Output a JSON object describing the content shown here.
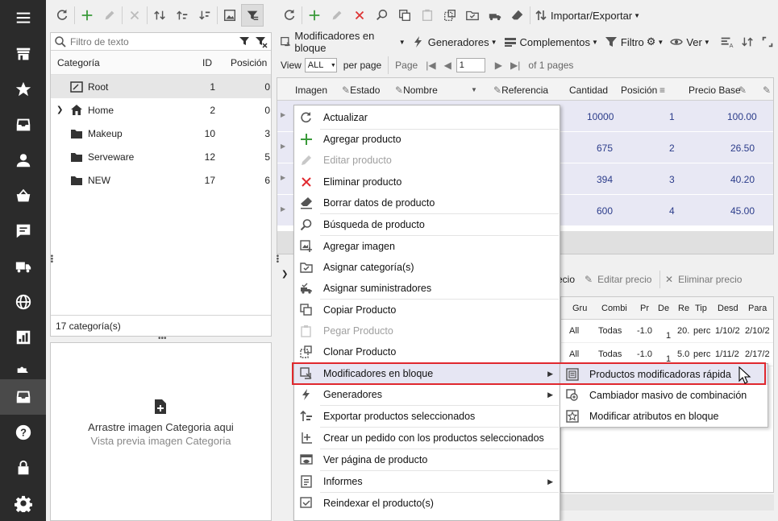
{
  "nav": {
    "items": [
      {
        "icon": "hamburger-icon"
      },
      {
        "icon": "store-icon"
      },
      {
        "icon": "star-icon"
      },
      {
        "icon": "inbox-icon"
      },
      {
        "icon": "person-icon"
      },
      {
        "icon": "basket-icon"
      },
      {
        "icon": "chat-icon"
      },
      {
        "icon": "truck-icon"
      },
      {
        "icon": "globe-icon"
      },
      {
        "icon": "chart-icon"
      },
      {
        "icon": "puzzle-icon"
      },
      {
        "icon": "products-icon"
      },
      {
        "icon": "help-icon"
      },
      {
        "icon": "lock-icon"
      },
      {
        "icon": "gear-icon"
      }
    ],
    "active_index": 11
  },
  "categories": {
    "filter_placeholder": "Filtro de texto",
    "columns": {
      "name": "Categoría",
      "id": "ID",
      "position": "Posición"
    },
    "rows": [
      {
        "name": "Root",
        "id": "1",
        "position": "0",
        "selected": true,
        "icon": "root-icon"
      },
      {
        "name": "Home",
        "id": "2",
        "position": "0",
        "icon": "home-icon",
        "expandable": true
      },
      {
        "name": "Makeup",
        "id": "10",
        "position": "3",
        "icon": "folder-icon"
      },
      {
        "name": "Serveware",
        "id": "12",
        "position": "5",
        "icon": "folder-icon"
      },
      {
        "name": "NEW",
        "id": "17",
        "position": "6",
        "icon": "folder-icon"
      }
    ],
    "count_label": "17 categoría(s)"
  },
  "image_panel": {
    "title": "Arrastre imagen Categoria aqui",
    "subtitle": "Vista previa imagen Categoria"
  },
  "product_toolbar": {
    "import_export": "Importar/Exportar",
    "bulk_modifiers": "Modificadores en bloque",
    "generators": "Generadores",
    "addons": "Complementos",
    "filter": "Filtro",
    "view": "Ver"
  },
  "pager": {
    "view_label": "View",
    "view_value": "ALL",
    "per_page": "per page",
    "page_label": "Page",
    "page_value": "1",
    "of_pages": "of 1 pages"
  },
  "grid": {
    "columns": [
      "Imagen",
      "Estado",
      "Nombre",
      "Referencia",
      "Cantidad",
      "Posición",
      "Precio Base"
    ],
    "rows": [
      {
        "cantidad": "10000",
        "posicion": "1",
        "precio": "100.00"
      },
      {
        "cantidad": "675",
        "posicion": "2",
        "precio": "26.50"
      },
      {
        "cantidad": "394",
        "posicion": "3",
        "precio": "40.20"
      },
      {
        "cantidad": "600",
        "posicion": "4",
        "precio": "45.00"
      }
    ]
  },
  "detail": {
    "partial_label": "ecio",
    "edit_price": "Editar precio",
    "delete_price": "Eliminar precio",
    "columns": [
      "Gru",
      "Combi",
      "Pr",
      "De",
      "Re",
      "Tip",
      "Desd",
      "Para"
    ],
    "rows": [
      [
        "All",
        "Todas",
        "-1.0",
        "1",
        "20.",
        "perc",
        "1/10/2",
        "2/10/2"
      ],
      [
        "All",
        "Todas",
        "-1.0",
        "1",
        "5.0",
        "perc",
        "1/11/2",
        "2/17/2"
      ]
    ]
  },
  "context_menu": {
    "items": [
      {
        "label": "Actualizar",
        "icon": "refresh-icon"
      },
      {
        "label": "Agregar producto",
        "icon": "plus-icon"
      },
      {
        "label": "Editar producto",
        "icon": "pencil-icon",
        "disabled": true
      },
      {
        "label": "Eliminar producto",
        "icon": "x-icon"
      },
      {
        "label": "Borrar datos de producto",
        "icon": "eraser-icon"
      },
      {
        "label": "Búsqueda de producto",
        "icon": "search-icon"
      },
      {
        "label": "Agregar imagen",
        "icon": "add-image-icon"
      },
      {
        "label": "Asignar categoría(s)",
        "icon": "assign-category-icon"
      },
      {
        "label": "Asignar suministradores",
        "icon": "assign-supplier-icon"
      },
      {
        "label": "Copiar Producto",
        "icon": "copy-icon"
      },
      {
        "label": "Pegar Producto",
        "icon": "paste-icon",
        "disabled": true
      },
      {
        "label": "Clonar Producto",
        "icon": "clone-icon"
      },
      {
        "label": "Modificadores en bloque",
        "icon": "bulk-modifiers-icon",
        "submenu": true,
        "highlighted": true
      },
      {
        "label": "Generadores",
        "icon": "lightning-icon",
        "submenu": true
      },
      {
        "label": "Exportar productos seleccionados",
        "icon": "export-icon"
      },
      {
        "label": "Crear un pedido con los productos seleccionados",
        "icon": "create-order-icon"
      },
      {
        "label": "Ver página de producto",
        "icon": "view-page-icon"
      },
      {
        "label": "Informes",
        "icon": "reports-icon",
        "submenu": true
      },
      {
        "label": "Reindexar el producto(s)",
        "icon": "reindex-icon"
      }
    ]
  },
  "submenu": {
    "items": [
      {
        "label": "Productos modificadoras rápida",
        "icon": "quick-edit-icon"
      },
      {
        "label": "Cambiador masivo de combinación",
        "icon": "combination-changer-icon"
      },
      {
        "label": "Modificar atributos en bloque",
        "icon": "attributes-star-icon"
      }
    ]
  },
  "colors": {
    "nav_bg": "#2b2b2b",
    "highlight_border": "#e0282e",
    "grid_row_bg": "#e8e8f4",
    "grid_value": "#2b3c8a"
  }
}
